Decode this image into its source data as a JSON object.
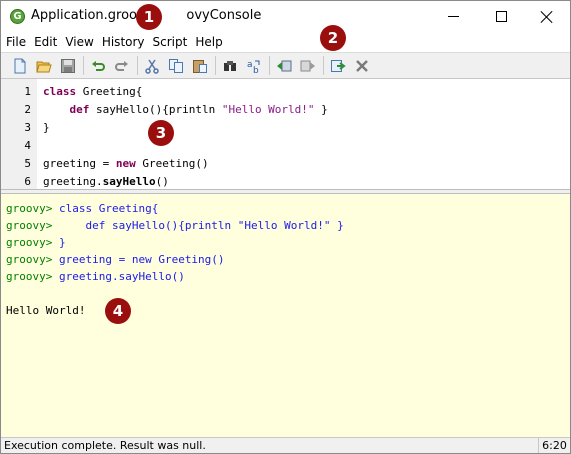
{
  "window": {
    "app_icon_letter": "G",
    "title_part1": "Application.groovy",
    "title_part2": "ovyConsole"
  },
  "menu": [
    "File",
    "Edit",
    "View",
    "History",
    "Script",
    "Help"
  ],
  "toolbar": {
    "buttons": [
      "new-file-icon",
      "open-icon",
      "save-icon",
      "undo-icon",
      "redo-icon",
      "cut-icon",
      "copy-icon",
      "paste-icon",
      "find-icon",
      "replace-icon",
      "history-previous-icon",
      "history-next-icon",
      "run-script-icon",
      "interrupt-icon"
    ]
  },
  "editor": {
    "line_numbers": [
      "1",
      "2",
      "3",
      "4",
      "5",
      "6"
    ],
    "lines": [
      {
        "kw": "class",
        "rest": " Greeting{"
      },
      {
        "pre": "    ",
        "kw": "def",
        "mid": " sayHello(){println ",
        "str": "\"Hello World!\"",
        "post": " }"
      },
      {
        "text": "}"
      },
      {
        "text": ""
      },
      {
        "pre": "greeting = ",
        "kw": "new",
        "rest": " Greeting()"
      },
      {
        "pre": "greeting.",
        "method": "sayHello",
        "rest": "()"
      }
    ]
  },
  "output": {
    "prompt": "groovy>",
    "echo_lines": [
      "class Greeting{",
      "    def sayHello(){println \"Hello World!\" }",
      "}",
      "greeting = new Greeting()",
      "greeting.sayHello()"
    ],
    "result": "Hello World!"
  },
  "status": {
    "message": "Execution complete. Result was null.",
    "position": "6:20"
  },
  "callouts": [
    "1",
    "2",
    "3",
    "4"
  ],
  "colors": {
    "output_bg": "#ffffdd",
    "prompt": "#008000",
    "echo": "#1a1aee",
    "callout": "#9b0e0e"
  }
}
